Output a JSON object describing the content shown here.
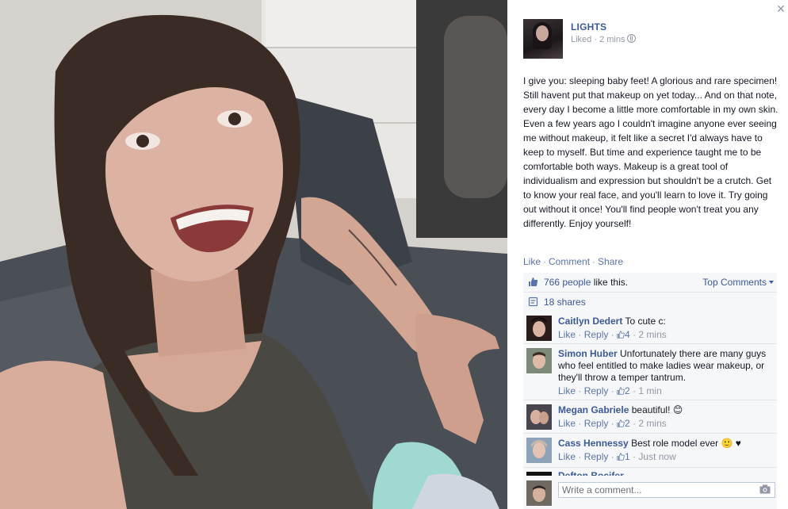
{
  "post": {
    "author": "LIGHTS",
    "meta_prefix": "Liked · 2 mins",
    "text": "I give you: sleeping baby feet! A glorious and rare specimen! Still havent put that makeup on yet today... And on that note, every day I become a little more comfortable in my own skin. Even a few years ago I couldn't imagine anyone ever seeing me without makeup, it felt like a secret I'd always have to keep to myself. But time and experience taught me to be comfortable both ways. Makeup is a great tool of individualism and expression but shouldn't be a crutch. Get to know your real face, and you'll learn to love it. Try going out without it once! You'll find people won't treat you any differently. Enjoy yourself!",
    "actions": [
      "Like",
      "Comment",
      "Share"
    ]
  },
  "likes": {
    "count_text": "766 people",
    "suffix": " like this.",
    "top_comments": "Top Comments"
  },
  "shares": {
    "text": "18 shares"
  },
  "comments": [
    {
      "name": "Caitlyn Dedert",
      "text": "To cute c:",
      "like": "Like",
      "reply": "Reply",
      "likes": "4",
      "time": "2 mins"
    },
    {
      "name": "Simon Huber",
      "text": "Unfortunately there are many guys who feel entitled to make ladies wear makeup, or they'll throw a temper tantrum.",
      "like": "Like",
      "reply": "Reply",
      "likes": "2",
      "time": "1 min"
    },
    {
      "name": "Megan Gabriele",
      "text": "beautiful! 😊",
      "like": "Like",
      "reply": "Reply",
      "likes": "2",
      "time": "2 mins"
    },
    {
      "name": "Cass Hennessy",
      "text": "Best role model ever 🙂 ♥",
      "like": "Like",
      "reply": "Reply",
      "likes": "1",
      "time": "Just now"
    },
    {
      "name": "Defton Bocifer",
      "text": ""
    }
  ],
  "composer": {
    "placeholder": "Write a comment..."
  },
  "icons": {
    "close": "close-icon",
    "globe": "globe-icon",
    "like": "thumbs-up-icon",
    "share": "share-icon",
    "camera": "camera-icon"
  },
  "colors": {
    "link": "#3b5998",
    "meta": "#9197a3",
    "ufi_bg": "#f6f7f9"
  }
}
